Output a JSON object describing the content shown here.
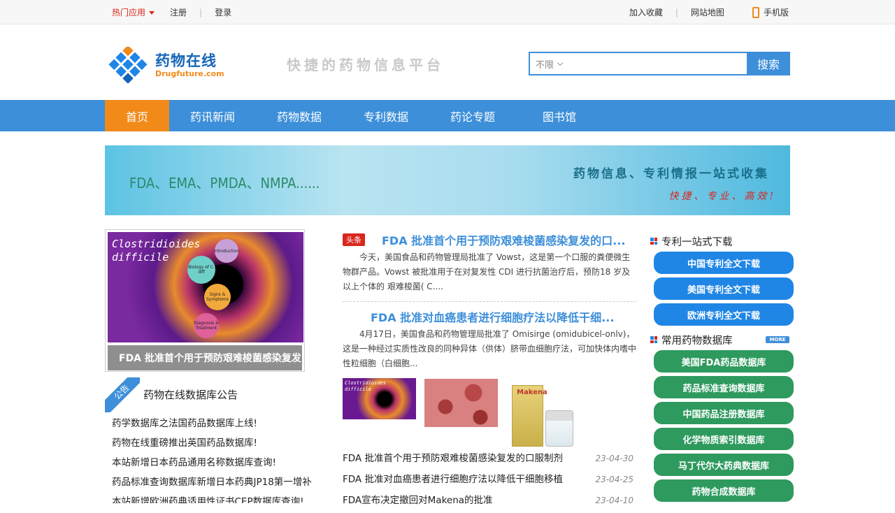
{
  "topbar": {
    "hot_apps": "热门应用",
    "register": "注册",
    "login": "登录",
    "favorite": "加入收藏",
    "sitemap": "网站地图",
    "mobile": "手机版"
  },
  "header": {
    "logo_cn": "药物在线",
    "logo_en": "Drugfuture.com",
    "slogan": "快捷的药物信息平台",
    "search": {
      "scope": "不限",
      "value": "",
      "button": "搜索"
    }
  },
  "nav": {
    "items": [
      "首页",
      "药讯新闻",
      "药物数据",
      "专利数据",
      "药论专题",
      "图书馆"
    ],
    "active": "首页"
  },
  "banner": {
    "left": "FDA、EMA、PMDA、NMPA......",
    "right1": "药物信息、专利情报一站式收集",
    "right2": "快捷、专业、高效!"
  },
  "featured": {
    "image_title": "Clostridioides difficile",
    "bubbles": [
      "Introduction",
      "Biology of C. diff",
      "Signs & Symptoms",
      "Diagnosis & Treatment"
    ],
    "caption": "FDA 批准首个用于预防艰难梭菌感染复发"
  },
  "notice": {
    "tag": "公告",
    "title": "药物在线数据库公告",
    "items": [
      "药学数据库之法国药品数据库上线!",
      "药物在线重磅推出英国药品数据库!",
      "本站新增日本药品通用名称数据库查询!",
      "药品标准查询数据库新增日本药典JP18第一增补",
      "本站新增欧洲药典适用性证书CEP数据库查询!"
    ]
  },
  "news": {
    "badge": "头条",
    "headline1": "FDA 批准首个用于预防艰难梭菌感染复发的口...",
    "summary1": "今天，美国食品和药物管理局批准了 Vowst，这是第一个口服的粪便微生物群产品。Vowst 被批准用于在对复发性 CDI 进行抗菌治疗后，预防18 岁及以上个体的 艰难梭菌( C....",
    "headline2": "FDA 批准对血癌患者进行细胞疗法以降低干细...",
    "summary2": "4月17日，美国食品和药物管理局批准了 Omisirge (omidubicel-onlv)，这是一种经过实质性改良的同种异体（供体）脐带血细胞疗法，可加快体内嗜中性粒细胞（白细胞...",
    "thumb1_text": "Clostridioides difficile",
    "thumb3_text": "Makena",
    "list": [
      {
        "title": "FDA 批准首个用于预防艰难梭菌感染复发的口服制剂",
        "date": "23-04-30"
      },
      {
        "title": "FDA 批准对血癌患者进行细胞疗法以降低干细胞移植",
        "date": "23-04-25"
      },
      {
        "title": "FDA宣布决定撤回对Makena的批准",
        "date": "23-04-10"
      }
    ]
  },
  "sidebar": {
    "patent_title": "专利一站式下载",
    "patent_buttons": [
      "中国专利全文下载",
      "美国专利全文下载",
      "欧洲专利全文下载"
    ],
    "db_title": "常用药物数据库",
    "more": "MORE",
    "db_buttons": [
      "美国FDA药品数据库",
      "药品标准查询数据库",
      "中国药品注册数据库",
      "化学物质索引数据库",
      "马丁代尔大药典数据库",
      "药物合成数据库"
    ],
    "colors": {
      "blue": "#1f86e6",
      "green": "#2e9a5e"
    }
  }
}
